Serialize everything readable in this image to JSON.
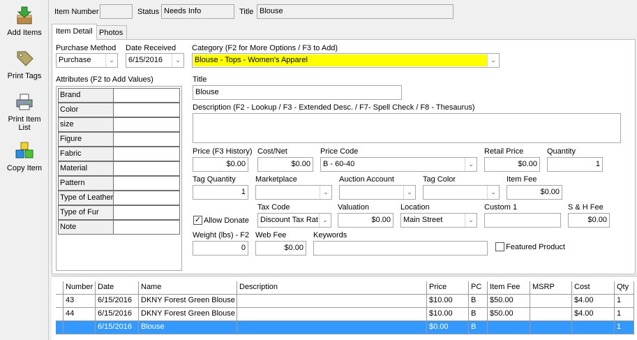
{
  "toolbar": {
    "add_items": "Add Items",
    "print_tags": "Print Tags",
    "print_item_list_1": "Print Item",
    "print_item_list_2": "List",
    "copy_item": "Copy Item"
  },
  "header": {
    "item_number_label": "Item Number",
    "item_number_value": "",
    "status_label": "Status",
    "status_value": "Needs Info",
    "title_label": "Title",
    "title_value": "Blouse"
  },
  "tabs": [
    {
      "label": "Item Detail",
      "active": true
    },
    {
      "label": "Photos",
      "active": false
    }
  ],
  "form": {
    "purchase_method_label": "Purchase Method",
    "purchase_method_value": "Purchase",
    "date_received_label": "Date Received",
    "date_received_value": "6/15/2016",
    "category_label": "Category (F2 for More Options / F3 to Add)",
    "category_value": "Blouse - Tops - Women's Apparel",
    "attributes_label": "Attributes (F2 to Add Values)",
    "title_label": "Title",
    "title_value": "Blouse",
    "description_label": "Description (F2 - Lookup / F3 - Extended Desc. / F7- Spell Check / F8 - Thesaurus)",
    "description_value": "",
    "price_label": "Price (F3 History)",
    "price_value": "$0.00",
    "cost_net_label": "Cost/Net",
    "cost_net_value": "$0.00",
    "price_code_label": "Price Code",
    "price_code_value": "B - 60-40",
    "retail_price_label": "Retail Price",
    "retail_price_value": "$0.00",
    "quantity_label": "Quantity",
    "quantity_value": "1",
    "tag_quantity_label": "Tag Quantity",
    "tag_quantity_value": "1",
    "marketplace_label": "Marketplace",
    "marketplace_value": "",
    "auction_account_label": "Auction Account",
    "auction_account_value": "",
    "tag_color_label": "Tag Color",
    "tag_color_value": "",
    "item_fee_label": "Item Fee",
    "item_fee_value": "$0.00",
    "allow_donate_label": "Allow Donate",
    "allow_donate_checked": true,
    "tax_code_label": "Tax Code",
    "tax_code_value": "Discount Tax Rat",
    "valuation_label": "Valuation",
    "valuation_value": "$0.00",
    "location_label": "Location",
    "location_value": "Main Street",
    "custom1_label": "Custom 1",
    "custom1_value": "",
    "sh_fee_label": "S & H Fee",
    "sh_fee_value": "$0.00",
    "weight_label": "Weight (lbs) - F2",
    "weight_value": "0",
    "web_fee_label": "Web Fee",
    "web_fee_value": "$0.00",
    "keywords_label": "Keywords",
    "keywords_value": "",
    "featured_label": "Featured Product",
    "featured_checked": false
  },
  "attributes": [
    "Brand",
    "Color",
    "size",
    "Figure",
    "Fabric",
    "Material",
    "Pattern",
    "Type of Leather",
    "Type of Fur",
    "Note"
  ],
  "grid": {
    "columns": [
      "Number",
      "Date",
      "Name",
      "Description",
      "Price",
      "PC",
      "Item Fee",
      "MSRP",
      "Cost",
      "Qty"
    ],
    "rows": [
      [
        "43",
        "6/15/2016",
        "DKNY Forest Green Blouse",
        "",
        "$10.00",
        "B",
        "$50.00",
        "",
        "$4.00",
        "1"
      ],
      [
        "44",
        "6/15/2016",
        "DKNY Forest Green Blouse",
        "",
        "$10.00",
        "B",
        "$50.00",
        "",
        "$4.00",
        "1"
      ],
      [
        "",
        "6/15/2016",
        "Blouse",
        "",
        "$0.00",
        "B",
        "",
        "",
        "",
        "1"
      ]
    ]
  },
  "colors": {
    "category_highlight": "#ffff00",
    "selection": "#3399ff"
  }
}
